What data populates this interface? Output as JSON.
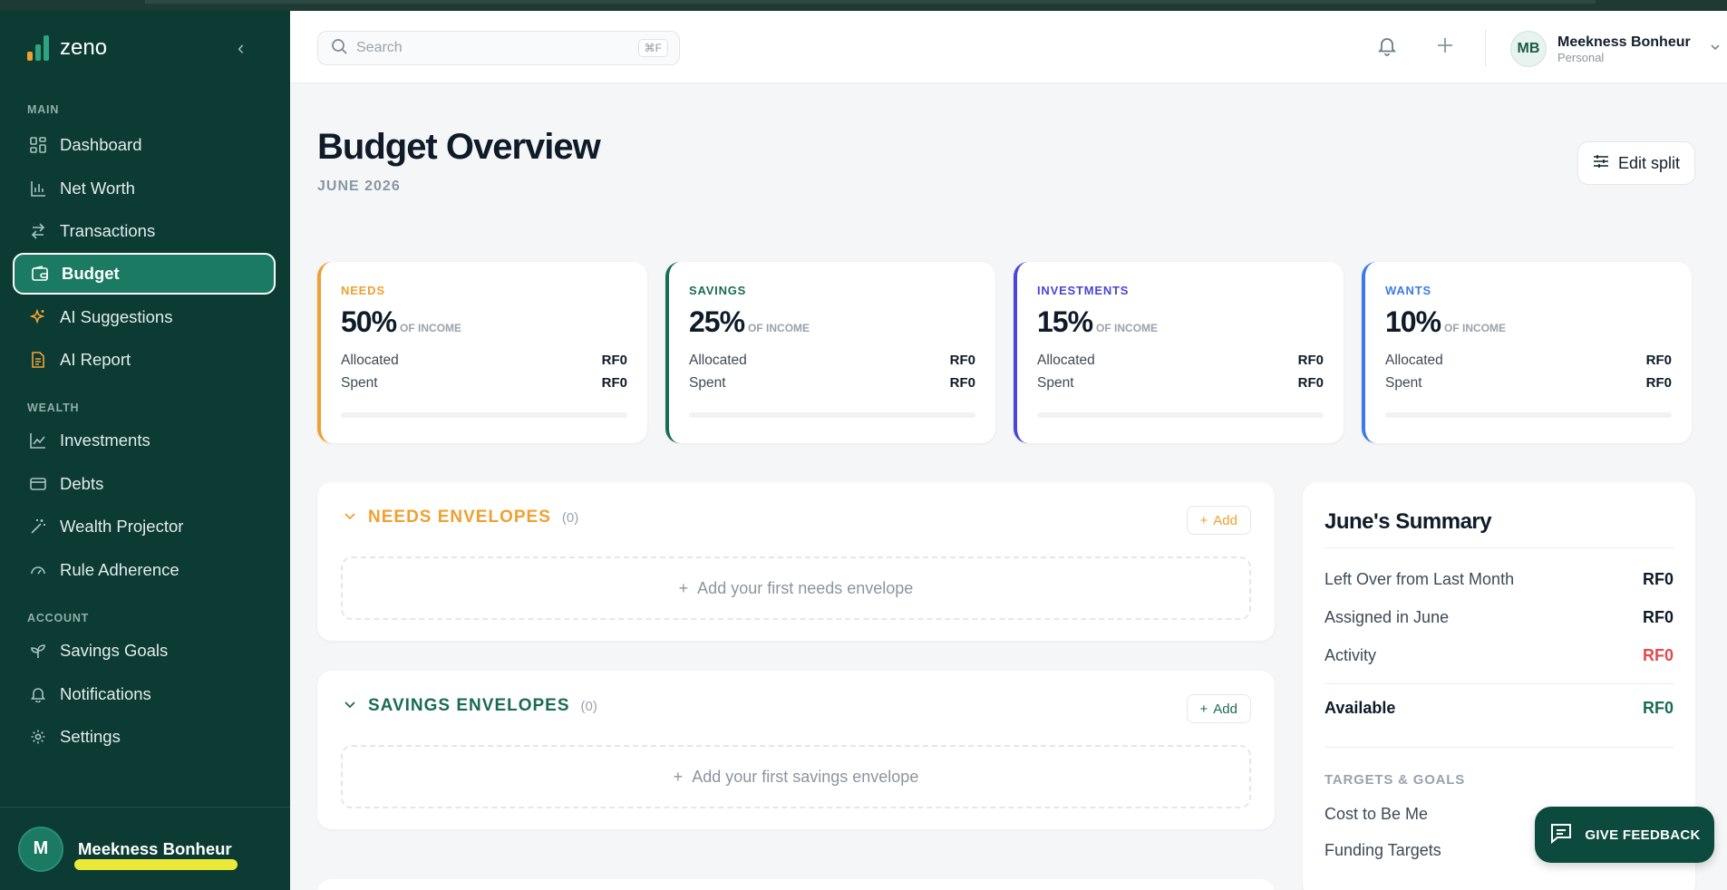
{
  "app": {
    "name": "zeno"
  },
  "sidebar": {
    "sections": {
      "main": "MAIN",
      "wealth": "WEALTH",
      "account": "ACCOUNT"
    },
    "items": [
      {
        "label": "Dashboard"
      },
      {
        "label": "Net Worth"
      },
      {
        "label": "Transactions"
      },
      {
        "label": "Budget"
      },
      {
        "label": "AI Suggestions"
      },
      {
        "label": "AI Report"
      },
      {
        "label": "Investments"
      },
      {
        "label": "Debts"
      },
      {
        "label": "Wealth Projector"
      },
      {
        "label": "Rule Adherence"
      },
      {
        "label": "Savings Goals"
      },
      {
        "label": "Notifications"
      },
      {
        "label": "Settings"
      }
    ],
    "active_item": "Budget",
    "user": {
      "initial": "M",
      "name": "Meekness Bonheur"
    }
  },
  "header": {
    "search_placeholder": "Search",
    "search_shortcut": "⌘F",
    "user": {
      "initials": "MB",
      "name": "Meekness Bonheur",
      "account": "Personal"
    }
  },
  "page": {
    "title": "Budget Overview",
    "subtitle": "JUNE 2026",
    "edit_split_label": "Edit split"
  },
  "cards": [
    {
      "label": "NEEDS",
      "percent": "50%",
      "suffix": "OF INCOME",
      "allocated_label": "Allocated",
      "allocated": "RF0",
      "spent_label": "Spent",
      "spent": "RF0",
      "color": "#f0a030",
      "progress": 0
    },
    {
      "label": "SAVINGS",
      "percent": "25%",
      "suffix": "OF INCOME",
      "allocated_label": "Allocated",
      "allocated": "RF0",
      "spent_label": "Spent",
      "spent": "RF0",
      "color": "#1a6b55",
      "progress": 0
    },
    {
      "label": "INVESTMENTS",
      "percent": "15%",
      "suffix": "OF INCOME",
      "allocated_label": "Allocated",
      "allocated": "RF0",
      "spent_label": "Spent",
      "spent": "RF0",
      "color": "#4b45d8",
      "progress": 0
    },
    {
      "label": "WANTS",
      "percent": "10%",
      "suffix": "OF INCOME",
      "allocated_label": "Allocated",
      "allocated": "RF0",
      "spent_label": "Spent",
      "spent": "RF0",
      "color": "#3d7ae8",
      "progress": 0
    }
  ],
  "envelopes": [
    {
      "title": "NEEDS ENVELOPES",
      "count": "(0)",
      "add_label": "Add",
      "empty_label": "Add your first needs envelope",
      "color": "#f0a030"
    },
    {
      "title": "SAVINGS ENVELOPES",
      "count": "(0)",
      "add_label": "Add",
      "empty_label": "Add your first savings envelope",
      "color": "#1a6b55"
    }
  ],
  "summary": {
    "title": "June's Summary",
    "rows": [
      {
        "label": "Left Over from Last Month",
        "value": "RF0"
      },
      {
        "label": "Assigned in June",
        "value": "RF0"
      },
      {
        "label": "Activity",
        "value": "RF0"
      }
    ],
    "available_label": "Available",
    "available_value": "RF0",
    "targets_heading": "TARGETS & GOALS",
    "links": [
      "Cost to Be Me",
      "Funding Targets"
    ]
  },
  "feedback_label": "GIVE FEEDBACK",
  "colors": {
    "sidebar_bg": "#0b3b33",
    "accent": "#1a7a62",
    "activity_negative": "#e5484d",
    "available_positive": "#1a6b55"
  }
}
